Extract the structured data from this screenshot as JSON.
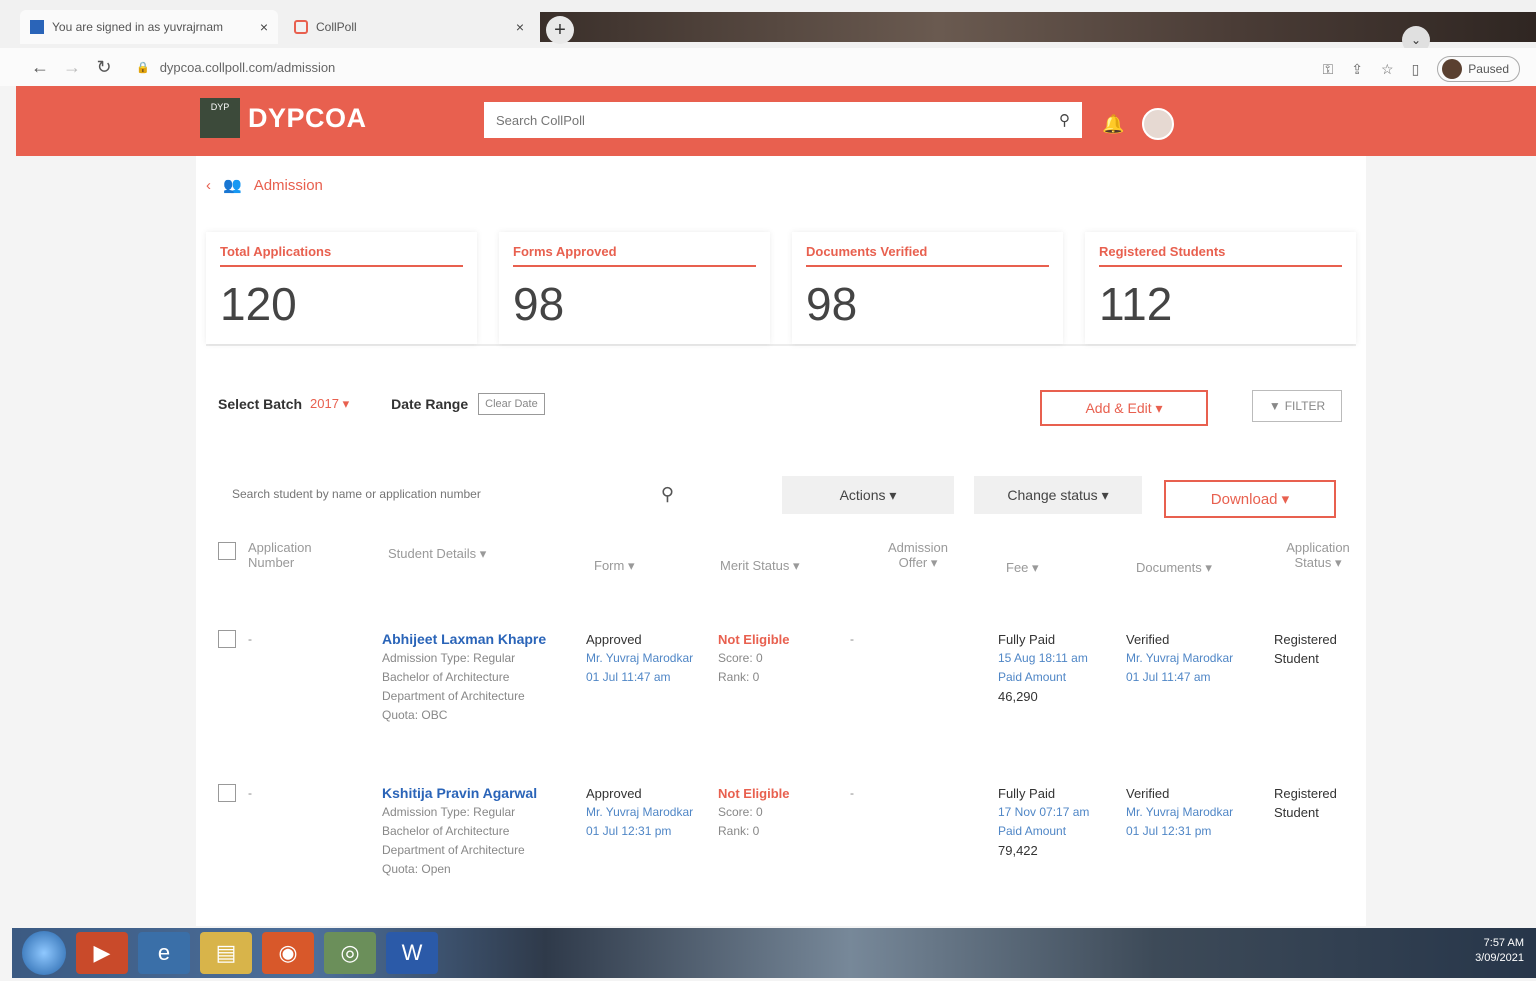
{
  "browser": {
    "tabs": [
      {
        "label": "You are signed in as yuvrajrnam"
      },
      {
        "label": "CollPoll"
      }
    ],
    "url": "dypcoa.collpoll.com/admission",
    "profile_label": "Paused"
  },
  "app": {
    "brand": "DYPCOA",
    "logo_text": "DYP",
    "search_placeholder": "Search CollPoll"
  },
  "breadcrumb": {
    "label": "Admission"
  },
  "stats": [
    {
      "label": "Total Applications",
      "value": "120"
    },
    {
      "label": "Forms Approved",
      "value": "98"
    },
    {
      "label": "Documents Verified",
      "value": "98"
    },
    {
      "label": "Registered Students",
      "value": "112"
    }
  ],
  "filters": {
    "batch_label": "Select Batch",
    "batch_value": "2017 ▾",
    "date_range_label": "Date Range",
    "clear_date": "Clear Date",
    "add_edit": "Add & Edit ▾",
    "filter": "FILTER"
  },
  "toolbar": {
    "student_search_placeholder": "Search student by name or application number",
    "actions": "Actions ▾",
    "change_status": "Change status ▾",
    "download": "Download ▾"
  },
  "table": {
    "headers": {
      "application_number": "Application Number",
      "student_details": "Student Details ▾",
      "form": "Form ▾",
      "merit_status": "Merit Status ▾",
      "admission_offer": "Admission Offer ▾",
      "fee": "Fee ▾",
      "documents": "Documents ▾",
      "application_status": "Application Status ▾"
    },
    "rows": [
      {
        "app_no": "-",
        "name": "Abhijeet Laxman Khapre",
        "admission_type": "Admission Type: Regular",
        "program": "Bachelor of Architecture",
        "department": "Department of Architecture",
        "quota": "Quota: OBC",
        "form_status": "Approved",
        "form_by": "Mr. Yuvraj Marodkar",
        "form_time": "01 Jul 11:47 am",
        "merit_status": "Not Eligible",
        "merit_score": "Score: 0",
        "merit_rank": "Rank: 0",
        "offer": "-",
        "fee_status": "Fully Paid",
        "fee_time": "15 Aug 18:11 am",
        "fee_paid_label": "Paid Amount",
        "fee_amount": "46,290",
        "doc_status": "Verified",
        "doc_by": "Mr. Yuvraj Marodkar",
        "doc_time": "01 Jul 11:47 am",
        "app_status": "Registered Student"
      },
      {
        "app_no": "-",
        "name": "Kshitija Pravin Agarwal",
        "admission_type": "Admission Type: Regular",
        "program": "Bachelor of Architecture",
        "department": "Department of Architecture",
        "quota": "Quota: Open",
        "form_status": "Approved",
        "form_by": "Mr. Yuvraj Marodkar",
        "form_time": "01 Jul 12:31 pm",
        "merit_status": "Not Eligible",
        "merit_score": "Score: 0",
        "merit_rank": "Rank: 0",
        "offer": "-",
        "fee_status": "Fully Paid",
        "fee_time": "17 Nov 07:17 am",
        "fee_paid_label": "Paid Amount",
        "fee_amount": "79,422",
        "doc_status": "Verified",
        "doc_by": "Mr. Yuvraj Marodkar",
        "doc_time": "01 Jul 12:31 pm",
        "app_status": "Registered Student"
      }
    ]
  },
  "taskbar": {
    "time": "7:57 AM",
    "date": "3/09/2021"
  },
  "colors": {
    "accent": "#e8604f",
    "link": "#2a64b8"
  }
}
